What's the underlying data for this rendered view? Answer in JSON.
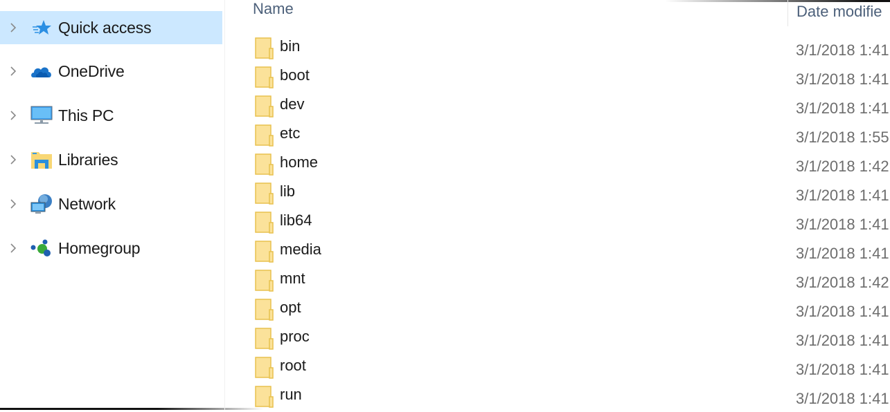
{
  "sidebar": {
    "items": [
      {
        "label": "Quick access",
        "icon": "quick-access-star-icon",
        "selected": true
      },
      {
        "label": "OneDrive",
        "icon": "onedrive-cloud-icon",
        "selected": false
      },
      {
        "label": "This PC",
        "icon": "this-pc-monitor-icon",
        "selected": false
      },
      {
        "label": "Libraries",
        "icon": "libraries-folder-icon",
        "selected": false
      },
      {
        "label": "Network",
        "icon": "network-globe-icon",
        "selected": false
      },
      {
        "label": "Homegroup",
        "icon": "homegroup-icon",
        "selected": false
      }
    ]
  },
  "list": {
    "columns": {
      "name": "Name",
      "date": "Date modifie"
    },
    "rows": [
      {
        "name": "bin",
        "date": "3/1/2018 1:41"
      },
      {
        "name": "boot",
        "date": "3/1/2018 1:41"
      },
      {
        "name": "dev",
        "date": "3/1/2018 1:41"
      },
      {
        "name": "etc",
        "date": "3/1/2018 1:55"
      },
      {
        "name": "home",
        "date": "3/1/2018 1:42"
      },
      {
        "name": "lib",
        "date": "3/1/2018 1:41"
      },
      {
        "name": "lib64",
        "date": "3/1/2018 1:41"
      },
      {
        "name": "media",
        "date": "3/1/2018 1:41"
      },
      {
        "name": "mnt",
        "date": "3/1/2018 1:42"
      },
      {
        "name": "opt",
        "date": "3/1/2018 1:41"
      },
      {
        "name": "proc",
        "date": "3/1/2018 1:41"
      },
      {
        "name": "root",
        "date": "3/1/2018 1:41"
      },
      {
        "name": "run",
        "date": "3/1/2018 1:41"
      }
    ]
  },
  "colors": {
    "selection": "#cce8ff",
    "folder": "#f8d775",
    "folder_border": "#e8c14e",
    "header_text": "#4c607a",
    "date_text": "#6d6d6d"
  }
}
